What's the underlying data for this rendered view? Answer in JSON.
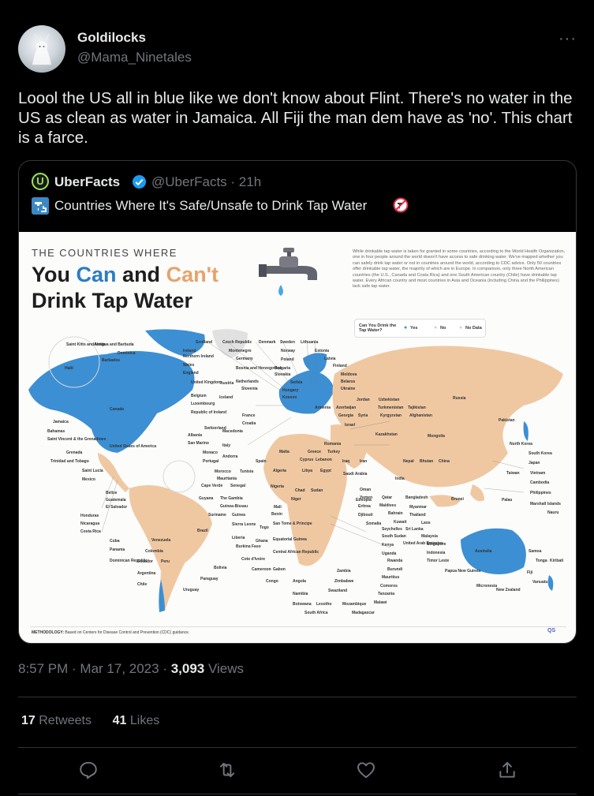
{
  "author": {
    "name": "Goldilocks",
    "handle": "@Mama_Ninetales",
    "avatar_icon": "avatar-illustration"
  },
  "tweet_text": "Loool the US all in blue like we don't know about Flint. There's no water in the US as clean as water in Jamaica. All Fiji the man dem have as 'no'. This chart is a farce.",
  "quote": {
    "name": "UberFacts",
    "handle": "@UberFacts",
    "age": "· 21h",
    "text": "Countries Where It's Safe/Unsafe to Drink Tap Water",
    "leading_icon": "tap-water-emoji",
    "trailing_icon": "non-potable-water-emoji",
    "infographic": {
      "kicker": "THE COUNTRIES WHERE",
      "headline_1": "You",
      "headline_can": "Can",
      "headline_and": "and",
      "headline_cant": "Can't",
      "headline_2": "Drink Tap Water",
      "description": "While drinkable tap water is taken for granted in some countries, according to the World Health Organization, one in four people around the world doesn't have access to safe drinking water. We've mapped whether you can safely drink tap water or not in countries around the world, according to CDC advice. Only 50 countries offer drinkable tap water, the majority of which are in Europe. In comparison, only three North American countries (the U.S., Canada and Costa Rica) and one South American country (Chile) have drinkable tap water. Every African country and most countries in Asia and Oceania (including China and the Philippines) lack safe tap water.",
      "legend_title": "Can You Drink the Tap Water?",
      "legend_yes": "Yes",
      "legend_no": "No",
      "legend_nodata": "No Data",
      "methodology_label": "METHODOLOGY:",
      "methodology_text": "Based on Centers for Disease Control and Prevention (CDC) guidance.",
      "logo": "QS",
      "colors": {
        "yes": "#3c8fd3",
        "no": "#efc8a2",
        "nodata": "#e1e1e1",
        "water": "#fcfcfb"
      },
      "labels": [
        "Saint Kitts and Nevis",
        "Antigua and Barbuda",
        "Dominica",
        "Barbados",
        "Haiti",
        "Canada",
        "Jamaica",
        "Bahamas",
        "Saint Vincent & the Grenadines",
        "Grenada",
        "Trinidad and Tobago",
        "United States of America",
        "Saint Lucia",
        "Mexico",
        "Belize",
        "Guatemala",
        "El Salvador",
        "Honduras",
        "Nicaragua",
        "Costa Rica",
        "Cuba",
        "Panama",
        "Dominican Republic",
        "Venezuela",
        "Colombia",
        "Ecuador",
        "Peru",
        "Argentina",
        "Chile",
        "Brazil",
        "Bolivia",
        "Paraguay",
        "Uruguay",
        "Scotland",
        "Czech Republic",
        "Denmark",
        "Sweden",
        "Lithuania",
        "Ireland",
        "Northern Ireland",
        "Wales",
        "England",
        "United Kingdom",
        "Belgium",
        "Luxembourg",
        "Iceland",
        "Montenegro",
        "Germany",
        "Bosnia and Herzegovina",
        "Austria",
        "Netherlands",
        "Slovenia",
        "Norway",
        "Poland",
        "Bulgaria",
        "Slovakia",
        "Serbia",
        "Hungary",
        "Kosovo",
        "Estonia",
        "Latvia",
        "Finland",
        "Moldova",
        "Belarus",
        "Ukraine",
        "Republic of Ireland",
        "France",
        "Croatia",
        "Switzerland",
        "Macedonia",
        "Albania",
        "San Marino",
        "Italy",
        "Monaco",
        "Andorra",
        "Portugal",
        "Spain",
        "Cape Verde",
        "Senegal",
        "Morocco",
        "Tunisia",
        "Mauritania",
        "Guyana",
        "The Gambia",
        "Guinea-Bissau",
        "Suriname",
        "Guinea",
        "Sierra Leone",
        "Liberia",
        "Burkina Faso",
        "Cote d'Ivoire",
        "Togo",
        "Ghana",
        "Benin",
        "Sao Tome & Principe",
        "Equatorial Guinea",
        "Central African Republic",
        "Cameroon",
        "Gabon",
        "Congo",
        "Angola",
        "Namibia",
        "Botswana",
        "Lesotho",
        "Mozambique",
        "South Africa",
        "Madagascar",
        "Swaziland",
        "Zimbabwe",
        "Zambia",
        "Malawi",
        "Tanzania",
        "Comoros",
        "Mauritius",
        "Burundi",
        "Rwanda",
        "Uganda",
        "Kenya",
        "South Sudan",
        "Somalia",
        "Djibouti",
        "Ethiopia",
        "Eritrea",
        "Sudan",
        "Chad",
        "Niger",
        "Mali",
        "Nigeria",
        "Libya",
        "Egypt",
        "Algeria",
        "Malta",
        "Greece",
        "Cyprus",
        "Lebanon",
        "Romania",
        "Turkey",
        "Armenia",
        "Azerbaijan",
        "Georgia",
        "Syria",
        "Israel",
        "Jordan",
        "Uzbekistan",
        "Turkmenistan",
        "Tajikistan",
        "Kyrgyzstan",
        "Afghanistan",
        "Kazakhstan",
        "Iraq",
        "Iran",
        "Saudi Arabia",
        "Oman",
        "Yemen",
        "Qatar",
        "Bahrain",
        "Kuwait",
        "United Arab Emirates",
        "Maldives",
        "Seychelles",
        "Sri Lanka",
        "India",
        "Nepal",
        "Bhutan",
        "Bangladesh",
        "Myanmar",
        "Thailand",
        "Laos",
        "Malaysia",
        "Singapore",
        "Indonesia",
        "Timor Leste",
        "Russia",
        "Mongolia",
        "China",
        "Pakistan",
        "North Korea",
        "South Korea",
        "Japan",
        "Taiwan",
        "Vietnam",
        "Cambodia",
        "Philippines",
        "Brunei",
        "Palau",
        "Marshall Islands",
        "Nauru",
        "Australia",
        "Papua New Guinea",
        "Micronesia",
        "Samoa",
        "Tonga",
        "Kiribati",
        "Fiji",
        "Vanuatu",
        "New Zealand"
      ]
    }
  },
  "timestamp": "8:57 PM · Mar 17, 2023 ·",
  "views_count": "3,093",
  "views_label": "Views",
  "retweets_count": "17",
  "retweets_label": "Retweets",
  "likes_count": "41",
  "likes_label": "Likes",
  "actions": [
    "reply-icon",
    "retweet-icon",
    "like-icon",
    "share-icon"
  ]
}
